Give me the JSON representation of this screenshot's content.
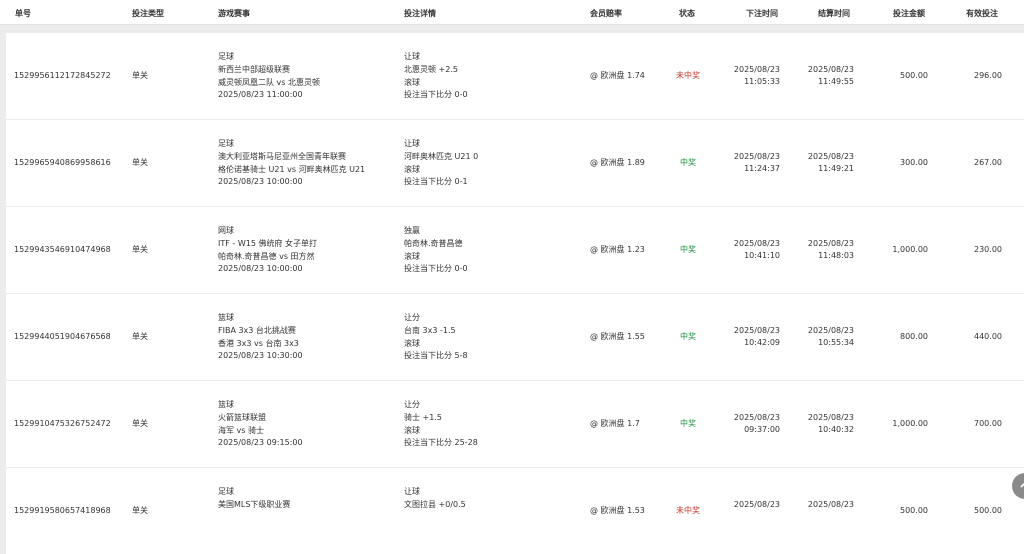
{
  "columns": {
    "order_no": "单号",
    "bet_type": "投注类型",
    "event": "游戏赛事",
    "details": "投注详情",
    "odds": "会员赔率",
    "status": "状态",
    "bet_time": "下注时间",
    "settle_time": "结算时间",
    "amount": "投注金额",
    "valid": "有效投注"
  },
  "rows": [
    {
      "order_no": "1529956112172845272",
      "bet_type": "单关",
      "sport": "足球",
      "league": "新西兰中部超级联赛",
      "match": "威灵顿凤凰二队 vs 北惠灵顿",
      "match_time": "2025/08/23 11:00:00",
      "market": "让球",
      "selection": "北惠灵顿 +2.5",
      "mode": "滚球",
      "score": "投注当下比分 0-0",
      "odds": "@ 欧洲盘 1.74",
      "status": "未中奖",
      "status_type": "lose",
      "bet_date": "2025/08/23",
      "bet_clock": "11:05:33",
      "settle_date": "2025/08/23",
      "settle_clock": "11:49:55",
      "amount": "500.00",
      "valid": "296.00"
    },
    {
      "order_no": "1529965940869958616",
      "bet_type": "单关",
      "sport": "足球",
      "league": "澳大利亚塔斯马尼亚州全国青年联赛",
      "match": "格伦诺基骑士 U21 vs 河畔奥林匹克 U21",
      "match_time": "2025/08/23 10:00:00",
      "market": "让球",
      "selection": "河畔奥林匹克 U21 0",
      "mode": "滚球",
      "score": "投注当下比分 0-1",
      "odds": "@ 欧洲盘 1.89",
      "status": "中奖",
      "status_type": "win",
      "bet_date": "2025/08/23",
      "bet_clock": "11:24:37",
      "settle_date": "2025/08/23",
      "settle_clock": "11:49:21",
      "amount": "300.00",
      "valid": "267.00"
    },
    {
      "order_no": "1529943546910474968",
      "bet_type": "单关",
      "sport": "网球",
      "league": "ITF - W15 佛统府 女子单打",
      "match": "帕奇林.奇普昌德 vs 田方然",
      "match_time": "2025/08/23 10:00:00",
      "market": "独赢",
      "selection": "帕奇林.奇普昌德",
      "mode": "滚球",
      "score": "投注当下比分 0-0",
      "odds": "@ 欧洲盘 1.23",
      "status": "中奖",
      "status_type": "win",
      "bet_date": "2025/08/23",
      "bet_clock": "10:41:10",
      "settle_date": "2025/08/23",
      "settle_clock": "11:48:03",
      "amount": "1,000.00",
      "valid": "230.00"
    },
    {
      "order_no": "1529944051904676568",
      "bet_type": "单关",
      "sport": "篮球",
      "league": "FIBA 3x3 台北挑战赛",
      "match": "香港 3x3 vs 台南 3x3",
      "match_time": "2025/08/23 10:30:00",
      "market": "让分",
      "selection": "台南 3x3 -1.5",
      "mode": "滚球",
      "score": "投注当下比分 5-8",
      "odds": "@ 欧洲盘 1.55",
      "status": "中奖",
      "status_type": "win",
      "bet_date": "2025/08/23",
      "bet_clock": "10:42:09",
      "settle_date": "2025/08/23",
      "settle_clock": "10:55:34",
      "amount": "800.00",
      "valid": "440.00"
    },
    {
      "order_no": "1529910475326752472",
      "bet_type": "单关",
      "sport": "篮球",
      "league": "火箭篮球联盟",
      "match": "海军 vs 骑士",
      "match_time": "2025/08/23 09:15:00",
      "market": "让分",
      "selection": "骑士 +1.5",
      "mode": "滚球",
      "score": "投注当下比分 25-28",
      "odds": "@ 欧洲盘 1.7",
      "status": "中奖",
      "status_type": "win",
      "bet_date": "2025/08/23",
      "bet_clock": "09:37:00",
      "settle_date": "2025/08/23",
      "settle_clock": "10:40:32",
      "amount": "1,000.00",
      "valid": "700.00"
    },
    {
      "order_no": "1529919580657418968",
      "bet_type": "单关",
      "sport": "足球",
      "league": "美国MLS下级职业赛",
      "match": "",
      "match_time": "",
      "market": "让球",
      "selection": "文图拉县 +0/0.5",
      "mode": "",
      "score": "",
      "odds": "@ 欧洲盘 1.53",
      "status": "未中奖",
      "status_type": "lose",
      "bet_date": "2025/08/23",
      "bet_clock": "",
      "settle_date": "2025/08/23",
      "settle_clock": "",
      "amount": "500.00",
      "valid": "500.00"
    }
  ],
  "scroll_button": {
    "icon": "chevron-up-icon"
  }
}
